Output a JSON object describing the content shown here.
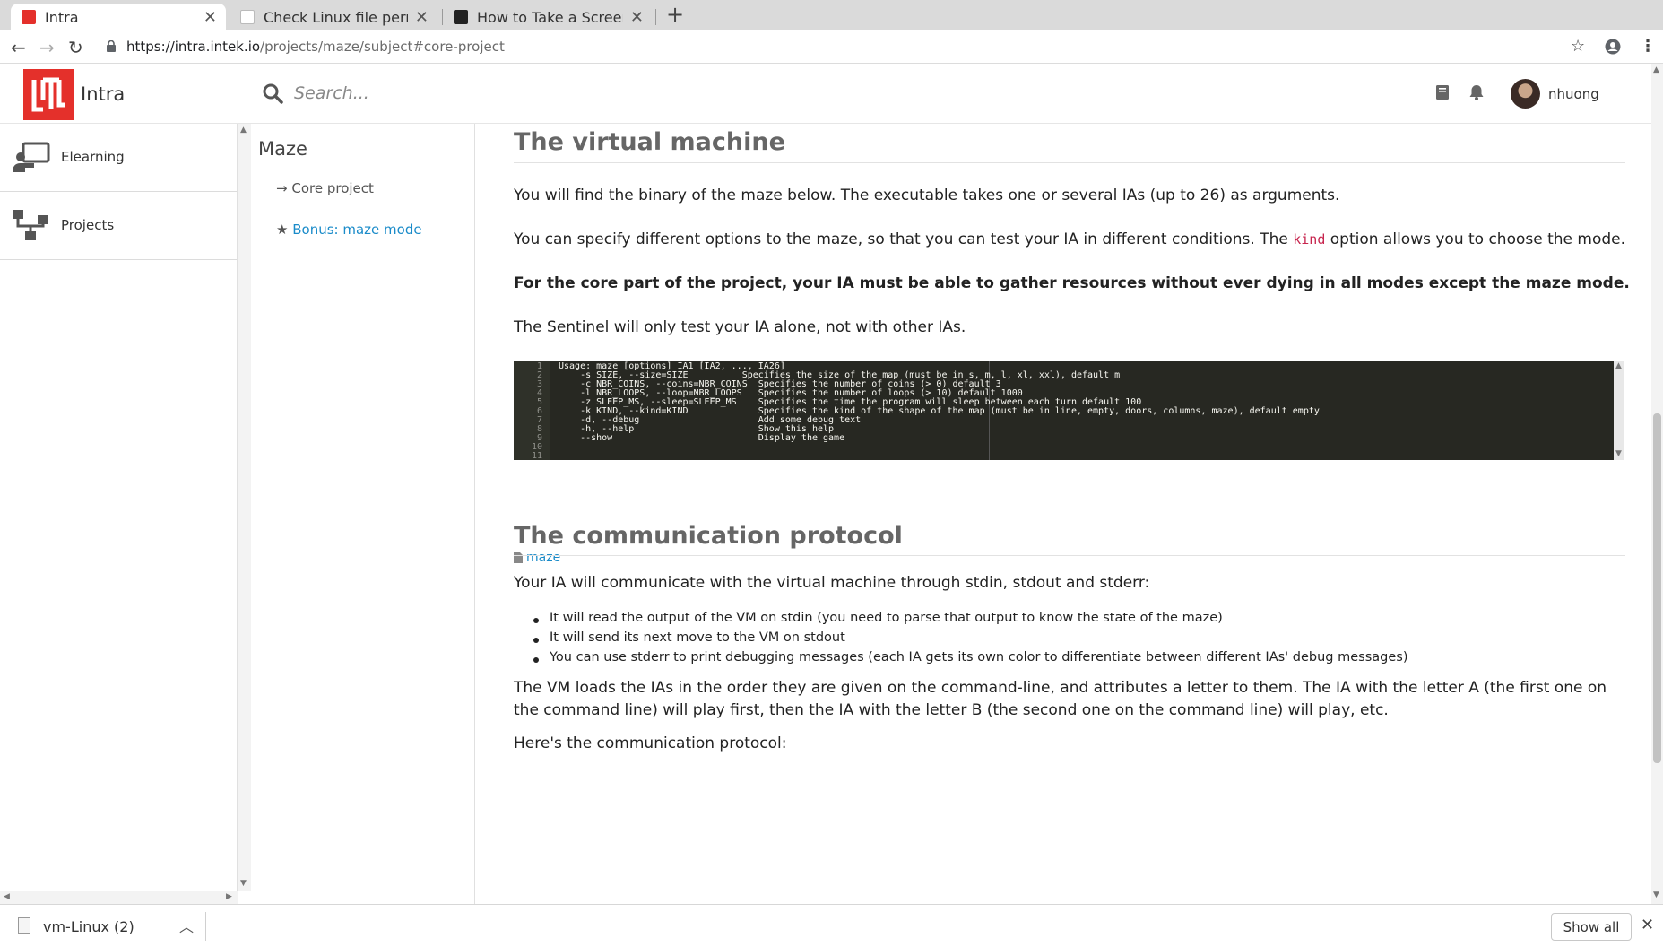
{
  "browser": {
    "tabs": [
      {
        "title": "Intra",
        "active": true
      },
      {
        "title": "Check Linux file permissio",
        "active": false
      },
      {
        "title": "How to Take a Screenshot",
        "active": false
      }
    ],
    "url_host": "https://intra.intek.io",
    "url_path": "/projects/maze/subject#core-project",
    "new_tab": "+"
  },
  "header": {
    "logo_text": "Intra",
    "search_placeholder": "Search...",
    "username": "nhuong"
  },
  "sidebar": {
    "items": [
      {
        "label": "Elearning",
        "icon": "elearning-icon"
      },
      {
        "label": "Projects",
        "icon": "projects-icon"
      }
    ]
  },
  "subnav": {
    "title": "Maze",
    "links": [
      {
        "label": "Core project",
        "prefix": "→",
        "active": false
      },
      {
        "label": "Bonus: maze mode",
        "prefix": "★",
        "active": true
      }
    ]
  },
  "content": {
    "section1_title": "The virtual machine",
    "p1": "You will find the binary of the maze below. The executable takes one or several IAs (up to 26) as arguments.",
    "p2_before": "You can specify different options to the maze, so that you can test your IA in different conditions. The ",
    "p2_code": "kind",
    "p2_after": " option allows you to choose the mode.",
    "p3": "For the core part of the project, your IA must be able to gather resources without ever dying in all modes except the maze mode.",
    "p4": "The Sentinel will only test your IA alone, not with other IAs.",
    "code_lines": [
      "Usage: maze [options] IA1 [IA2, ..., IA26]",
      "    -s SIZE, --size=SIZE          Specifies the size of the map (must be in s, m, l, xl, xxl), default m",
      "    -c NBR_COINS, --coins=NBR_COINS  Specifies the number of coins (> 0) default 3",
      "    -l NBR_LOOPS, --loop=NBR_LOOPS   Specifies the number of loops (> 10) default 1000",
      "    -z SLEEP_MS, --sleep=SLEEP_MS    Specifies the time the program will sleep between each turn default 100",
      "    -k KIND, --kind=KIND             Specifies the kind of the shape of the map (must be in line, empty, doors, columns, maze), default empty",
      "    -d, --debug                      Add some debug text",
      "    -h, --help                       Show this help",
      "    --show                           Display the game",
      "",
      ""
    ],
    "file_link": "maze",
    "section2_title": "The communication protocol",
    "p5": "Your IA will communicate with the virtual machine through stdin, stdout and stderr:",
    "bullets": [
      "It will read the output of the VM on stdin (you need to parse that output to know the state of the maze)",
      "It will send its next move to the VM on stdout",
      "You can use stderr to print debugging messages (each IA gets its own color to differentiate between different IAs' debug messages)"
    ],
    "p6": "The VM loads the IAs in the order they are given on the command-line, and attributes a letter to them. The IA with the letter A (the first one on the command line) will play first, then the IA with the letter B (the second one on the command line) will play, etc.",
    "p7": "Here's the communication protocol:"
  },
  "downloads": {
    "file_name": "vm-Linux (2)",
    "show_all": "Show all"
  },
  "colors": {
    "brand_red": "#e4302b",
    "link_blue": "#1a8bc9",
    "code_bg": "#272822"
  }
}
